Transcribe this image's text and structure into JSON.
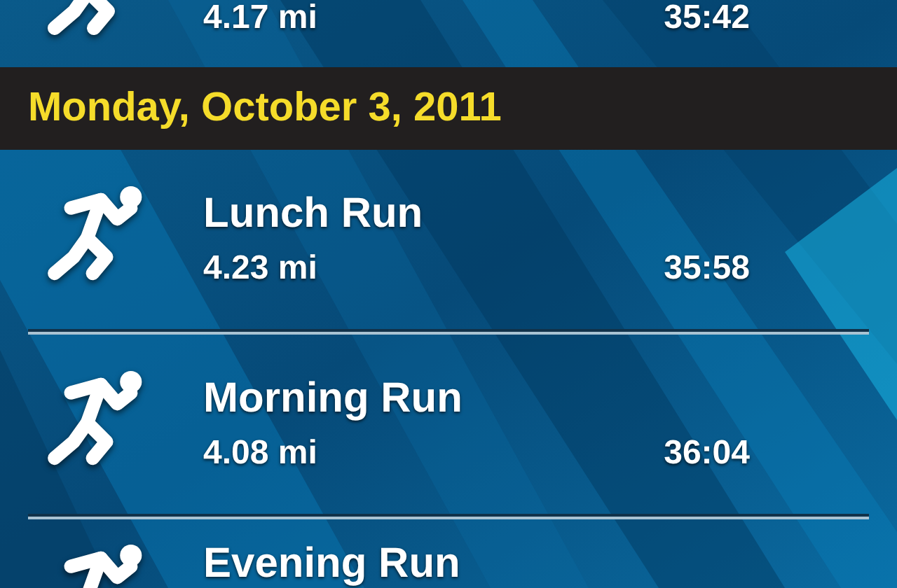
{
  "entries": [
    {
      "kind": "run",
      "distance": "4.17 mi",
      "time": "35:42"
    },
    {
      "kind": "date_header",
      "label": "Monday, October 3, 2011"
    },
    {
      "kind": "run",
      "name": "Lunch Run",
      "distance": "4.23 mi",
      "time": "35:58"
    },
    {
      "kind": "run",
      "name": "Morning Run",
      "distance": "4.08 mi",
      "time": "36:04"
    },
    {
      "kind": "run",
      "name": "Evening Run"
    }
  ]
}
